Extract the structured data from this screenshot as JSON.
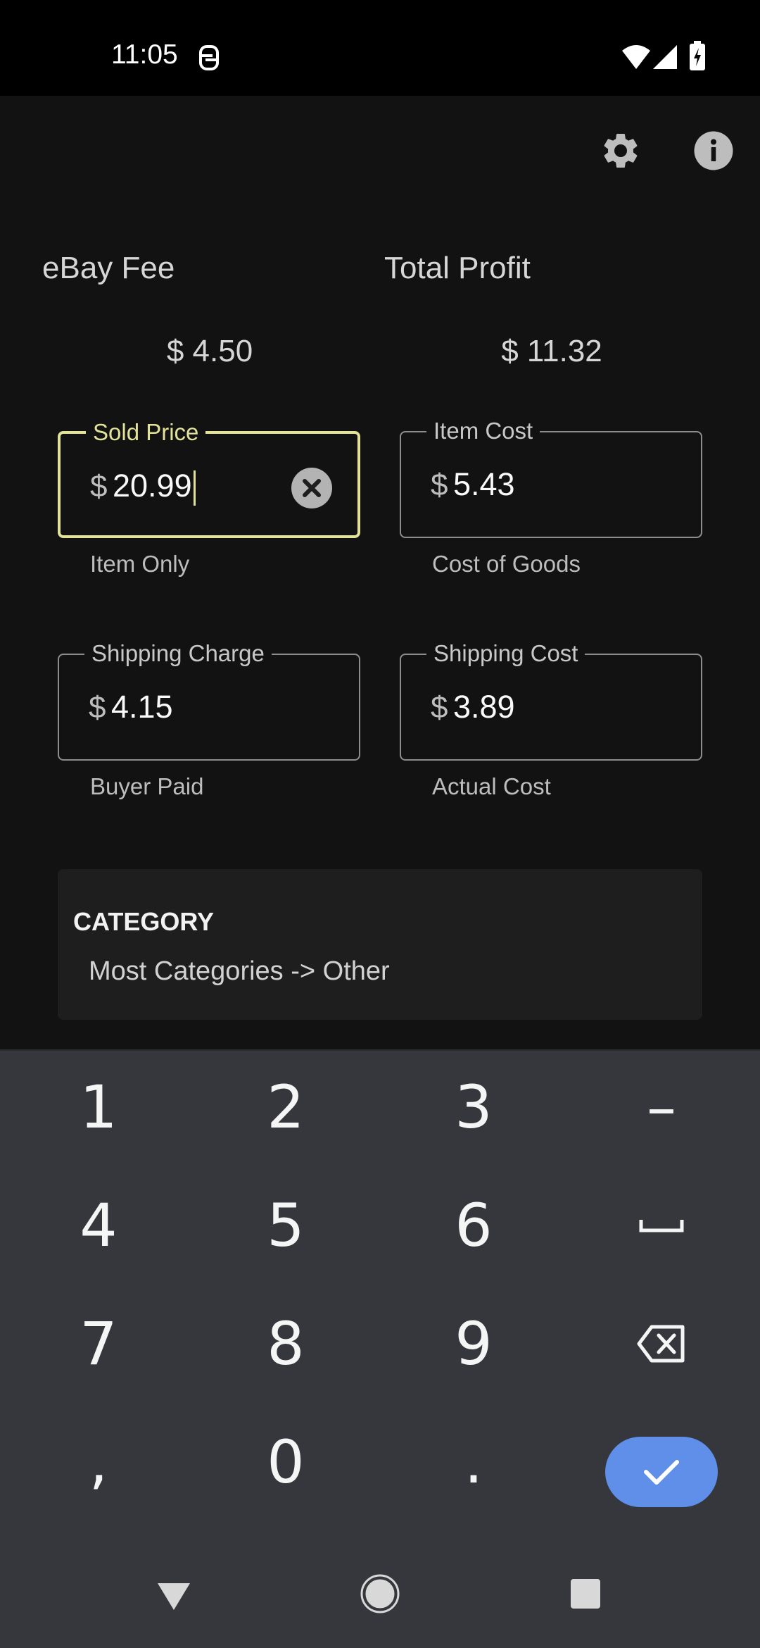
{
  "status_bar": {
    "time": "11:05",
    "icons": [
      "nfc-icon",
      "wifi-icon",
      "signal-icon",
      "battery-charging-icon"
    ]
  },
  "toolbar": {
    "icons": [
      "gear-icon",
      "info-icon"
    ]
  },
  "summary": {
    "fee_label": "eBay Fee",
    "fee_value": "$ 4.50",
    "profit_label": "Total Profit",
    "profit_value": "$ 11.32"
  },
  "fields": {
    "sold_price": {
      "label": "Sold Price",
      "prefix": "$",
      "value": "20.99",
      "helper": "Item Only",
      "focused": true
    },
    "item_cost": {
      "label": "Item Cost",
      "prefix": "$",
      "value": "5.43",
      "helper": "Cost of Goods"
    },
    "shipping_charge": {
      "label": "Shipping Charge",
      "prefix": "$",
      "value": "4.15",
      "helper": "Buyer Paid"
    },
    "shipping_cost": {
      "label": "Shipping Cost",
      "prefix": "$",
      "value": "3.89",
      "helper": "Actual Cost"
    }
  },
  "category": {
    "title": "CATEGORY",
    "value": "Most Categories -> Other"
  },
  "keyboard": {
    "row1": [
      "1",
      "2",
      "3",
      "–"
    ],
    "row2": [
      "4",
      "5",
      "6",
      "space-icon"
    ],
    "row3": [
      "7",
      "8",
      "9",
      "backspace-icon"
    ],
    "row4": [
      ",",
      "0",
      ".",
      "check-icon"
    ]
  },
  "nav_bar": {
    "icons": [
      "back-triangle-icon",
      "home-circle-icon",
      "recents-square-icon"
    ]
  },
  "colors": {
    "background": "#121212",
    "accent": "#e2e29a",
    "keyboard_bg": "#35373c",
    "done_key": "#5f8fe8"
  }
}
